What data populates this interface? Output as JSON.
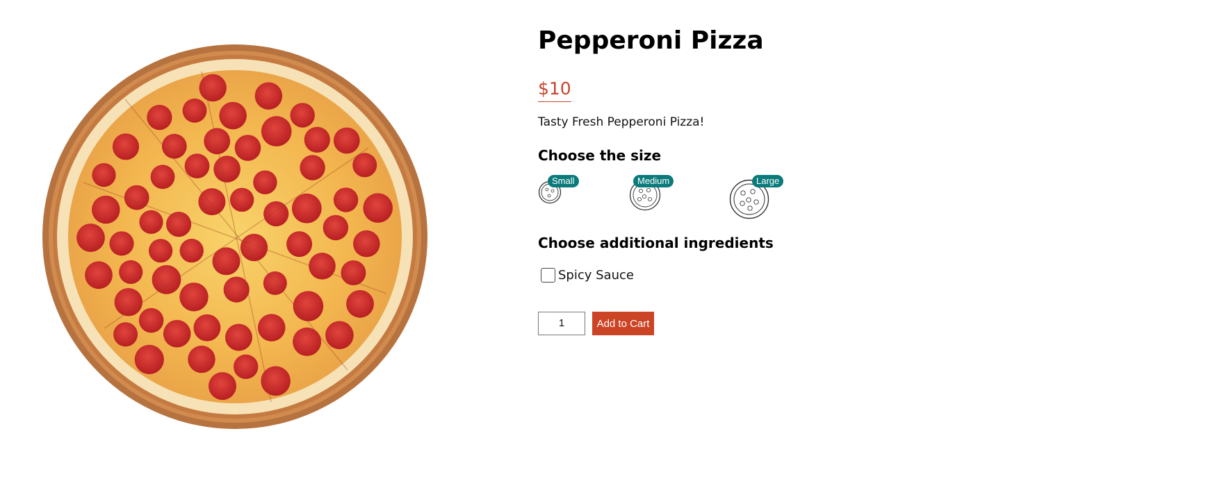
{
  "product": {
    "name": "Pepperoni Pizza",
    "price": "$10",
    "description": "Tasty Fresh Pepperoni Pizza!",
    "image_icon": "pepperoni-pizza-photo"
  },
  "size_section": {
    "heading": "Choose the size",
    "options": [
      {
        "label": "Small",
        "icon": "pizza-small-icon"
      },
      {
        "label": "Medium",
        "icon": "pizza-medium-icon"
      },
      {
        "label": "Large",
        "icon": "pizza-large-icon"
      }
    ]
  },
  "ingredients_section": {
    "heading": "Choose additional ingredients",
    "items": [
      {
        "label": "Spicy Sauce",
        "checked": false
      }
    ]
  },
  "cart": {
    "quantity": "1",
    "add_label": "Add to Cart"
  },
  "colors": {
    "accent_red": "#cc4426",
    "badge_teal": "#0b7a7a"
  }
}
